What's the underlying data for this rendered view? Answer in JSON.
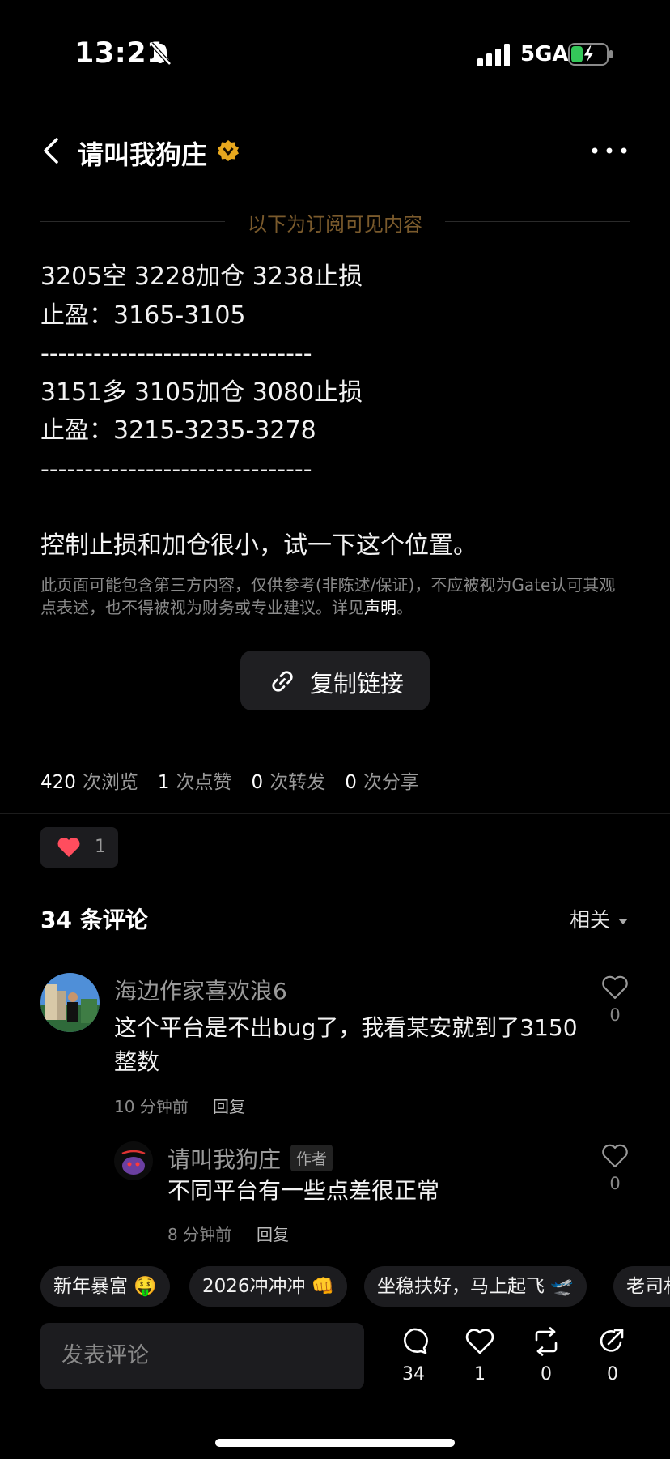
{
  "status_bar": {
    "time": "13:21",
    "network": "5GA"
  },
  "header": {
    "title": "请叫我狗庄"
  },
  "subscriber_divider": "以下为订阅可见内容",
  "post": {
    "lines": [
      "3205空 3228加仓 3238止损",
      "止盈：3165-3105",
      "-------------------------------",
      "3151多 3105加仓 3080止损",
      "止盈：3215-3235-3278",
      "-------------------------------"
    ],
    "summary": "控制止损和加仓很小，试一下这个位置。",
    "disclaimer_text": "此页面可能包含第三方内容，仅供参考(非陈述/保证)，不应被视为Gate认可其观点表述，也不得被视为财务或专业建议。详见",
    "disclaimer_link": "声明",
    "disclaimer_end": "。",
    "copy_link_label": "复制链接"
  },
  "stats": {
    "views": "420",
    "views_label": "次浏览",
    "likes": "1",
    "likes_label": "次点赞",
    "reposts": "0",
    "reposts_label": "次转发",
    "shares": "0",
    "shares_label": "次分享"
  },
  "reaction": {
    "count": "1"
  },
  "comments_section": {
    "title": "34 条评论",
    "sort": "相关"
  },
  "comments": [
    {
      "author": "海边作家喜欢浪6",
      "text": "这个平台是不出bug了，我看某安就到了3150整数",
      "time": "10 分钟前",
      "reply": "回复",
      "likes": "0"
    },
    {
      "author": "请叫我狗庄",
      "badge": "作者",
      "text": "不同平台有一些点差很正常",
      "time": "8 分钟前",
      "reply": "回复",
      "likes": "0"
    }
  ],
  "quick_chips": [
    "新年暴富 🤑",
    "2026冲冲冲 👊",
    "坐稳扶好，马上起飞 🛫",
    "老司机"
  ],
  "composer": {
    "placeholder": "发表评论"
  },
  "actions": {
    "comments": "34",
    "likes": "1",
    "reposts": "0",
    "shares": "0"
  },
  "colors": {
    "background": "#000000",
    "accent_gold": "#7a5a2c",
    "verified": "#e8a81e",
    "heart_red": "#ff4d5e"
  }
}
